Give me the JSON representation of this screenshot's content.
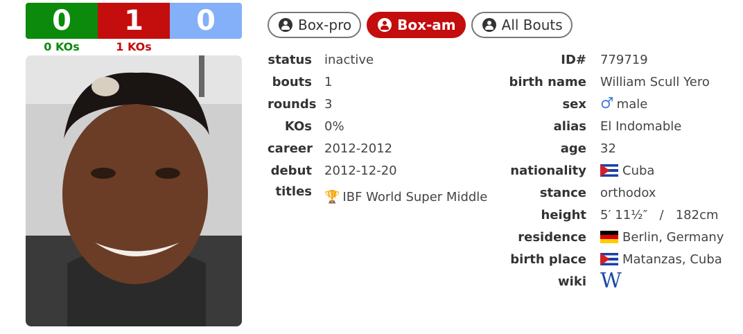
{
  "record": {
    "wins": "0",
    "losses": "1",
    "draws": "0",
    "wins_kos": "0 KOs",
    "losses_kos": "1 KOs"
  },
  "tabs": [
    {
      "label": "Box-pro",
      "active": false
    },
    {
      "label": "Box-am",
      "active": true
    },
    {
      "label": "All Bouts",
      "active": false
    }
  ],
  "left": {
    "status": {
      "label": "status",
      "value": "inactive"
    },
    "bouts": {
      "label": "bouts",
      "value": "1"
    },
    "rounds": {
      "label": "rounds",
      "value": "3"
    },
    "kos": {
      "label": "KOs",
      "value": "0%"
    },
    "career": {
      "label": "career",
      "value": "2012-2012"
    },
    "debut": {
      "label": "debut",
      "value": "2012-12-20"
    },
    "titles": {
      "label": "titles",
      "value": "IBF World Super Middle"
    }
  },
  "right": {
    "id": {
      "label": "ID#",
      "value": "779719"
    },
    "birth_name": {
      "label": "birth name",
      "value": "William Scull Yero"
    },
    "sex": {
      "label": "sex",
      "value": "male",
      "icon": "male-icon"
    },
    "alias": {
      "label": "alias",
      "value": "El Indomable"
    },
    "age": {
      "label": "age",
      "value": "32"
    },
    "nationality": {
      "label": "nationality",
      "value": "Cuba",
      "flag": "cuba-flag"
    },
    "stance": {
      "label": "stance",
      "value": "orthodox"
    },
    "height": {
      "label": "height",
      "value": "5′ 11½″   /   182cm"
    },
    "residence": {
      "label": "residence",
      "value": "Berlin, Germany",
      "flag": "germany-flag"
    },
    "birth_place": {
      "label": "birth place",
      "value": "Matanzas, Cuba",
      "flag": "cuba-flag"
    },
    "wiki": {
      "label": "wiki",
      "icon": "wikipedia-icon",
      "glyph": "W"
    }
  },
  "colors": {
    "win": "#0b8a0b",
    "loss": "#c40d0d",
    "draw": "#83b0f8"
  }
}
